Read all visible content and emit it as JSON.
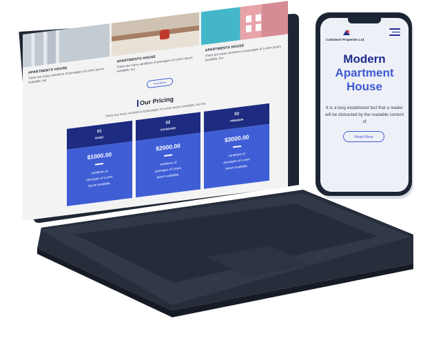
{
  "laptop": {
    "photos": [
      {
        "name": "apartment-photo-1"
      },
      {
        "name": "apartment-photo-2"
      },
      {
        "name": "apartment-photo-3"
      }
    ],
    "cards": [
      {
        "title": "APARTMENTS HOUSE",
        "text": "There are many variations of passages of Lorem Ipsum available, but"
      },
      {
        "title": "APARTMENTS HOUSE",
        "text": "There are many variations of passages of Lorem Ipsum available, but"
      },
      {
        "title": "APARTMENTS HOUSE",
        "text": "There are many variations of passages of Lorem Ipsum available, but"
      }
    ],
    "find_more_label": "Find More",
    "pricing": {
      "title": "Our Pricing",
      "subtitle": "There are many variations of passages of Lorem Ipsum available, but the",
      "plans": [
        {
          "number": "01",
          "name": "BASIC",
          "price": "$1000.00",
          "lines": [
            "variations of",
            "passages of Lorem",
            "Ipsum available,"
          ]
        },
        {
          "number": "02",
          "name": "STANDARD",
          "price": "$2000.00",
          "lines": [
            "variations of",
            "passages of Lorem",
            "Ipsum available,"
          ]
        },
        {
          "number": "03",
          "name": "PREMIUM",
          "price": "$3000.00",
          "lines": [
            "variations of",
            "passages of Lorem",
            "Ipsum available,"
          ]
        }
      ]
    }
  },
  "phone": {
    "brand": "Carbotech Properties Ltd.",
    "hero_line1": "Modern",
    "hero_line2": "Apartment",
    "hero_line3": "House",
    "hero_text": "It is a long established fact that a reader will be distracted by the readable content of",
    "read_more_label": "Read More"
  },
  "colors": {
    "accent_dark": "#1d2a8f",
    "accent": "#3d5ad1",
    "device_body": "#1c2533"
  },
  "icons": [
    "hamburger-menu-icon",
    "brand-logo-icon"
  ]
}
